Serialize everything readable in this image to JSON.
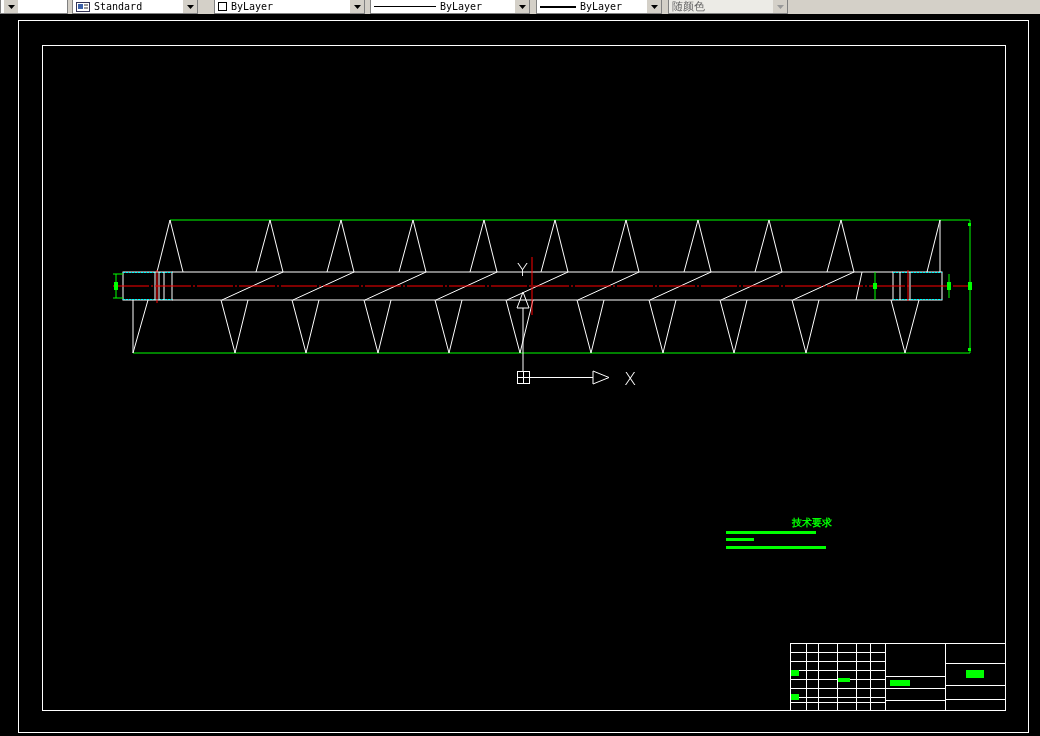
{
  "toolbar": {
    "dropdowns": [
      {
        "kind": "blank",
        "disabled": false
      },
      {
        "kind": "text-style",
        "value": "Standard",
        "disabled": false
      },
      {
        "kind": "layer-color",
        "value": "ByLayer",
        "disabled": false
      },
      {
        "kind": "linetype",
        "value": "ByLayer",
        "disabled": false
      },
      {
        "kind": "lineweight",
        "value": "ByLayer",
        "disabled": false
      },
      {
        "kind": "plot-style",
        "value": "随颜色",
        "disabled": true
      }
    ]
  },
  "canvas": {
    "ucs": {
      "x_label": "X",
      "y_label": "Y"
    },
    "notes": {
      "title": "技术要求"
    }
  }
}
